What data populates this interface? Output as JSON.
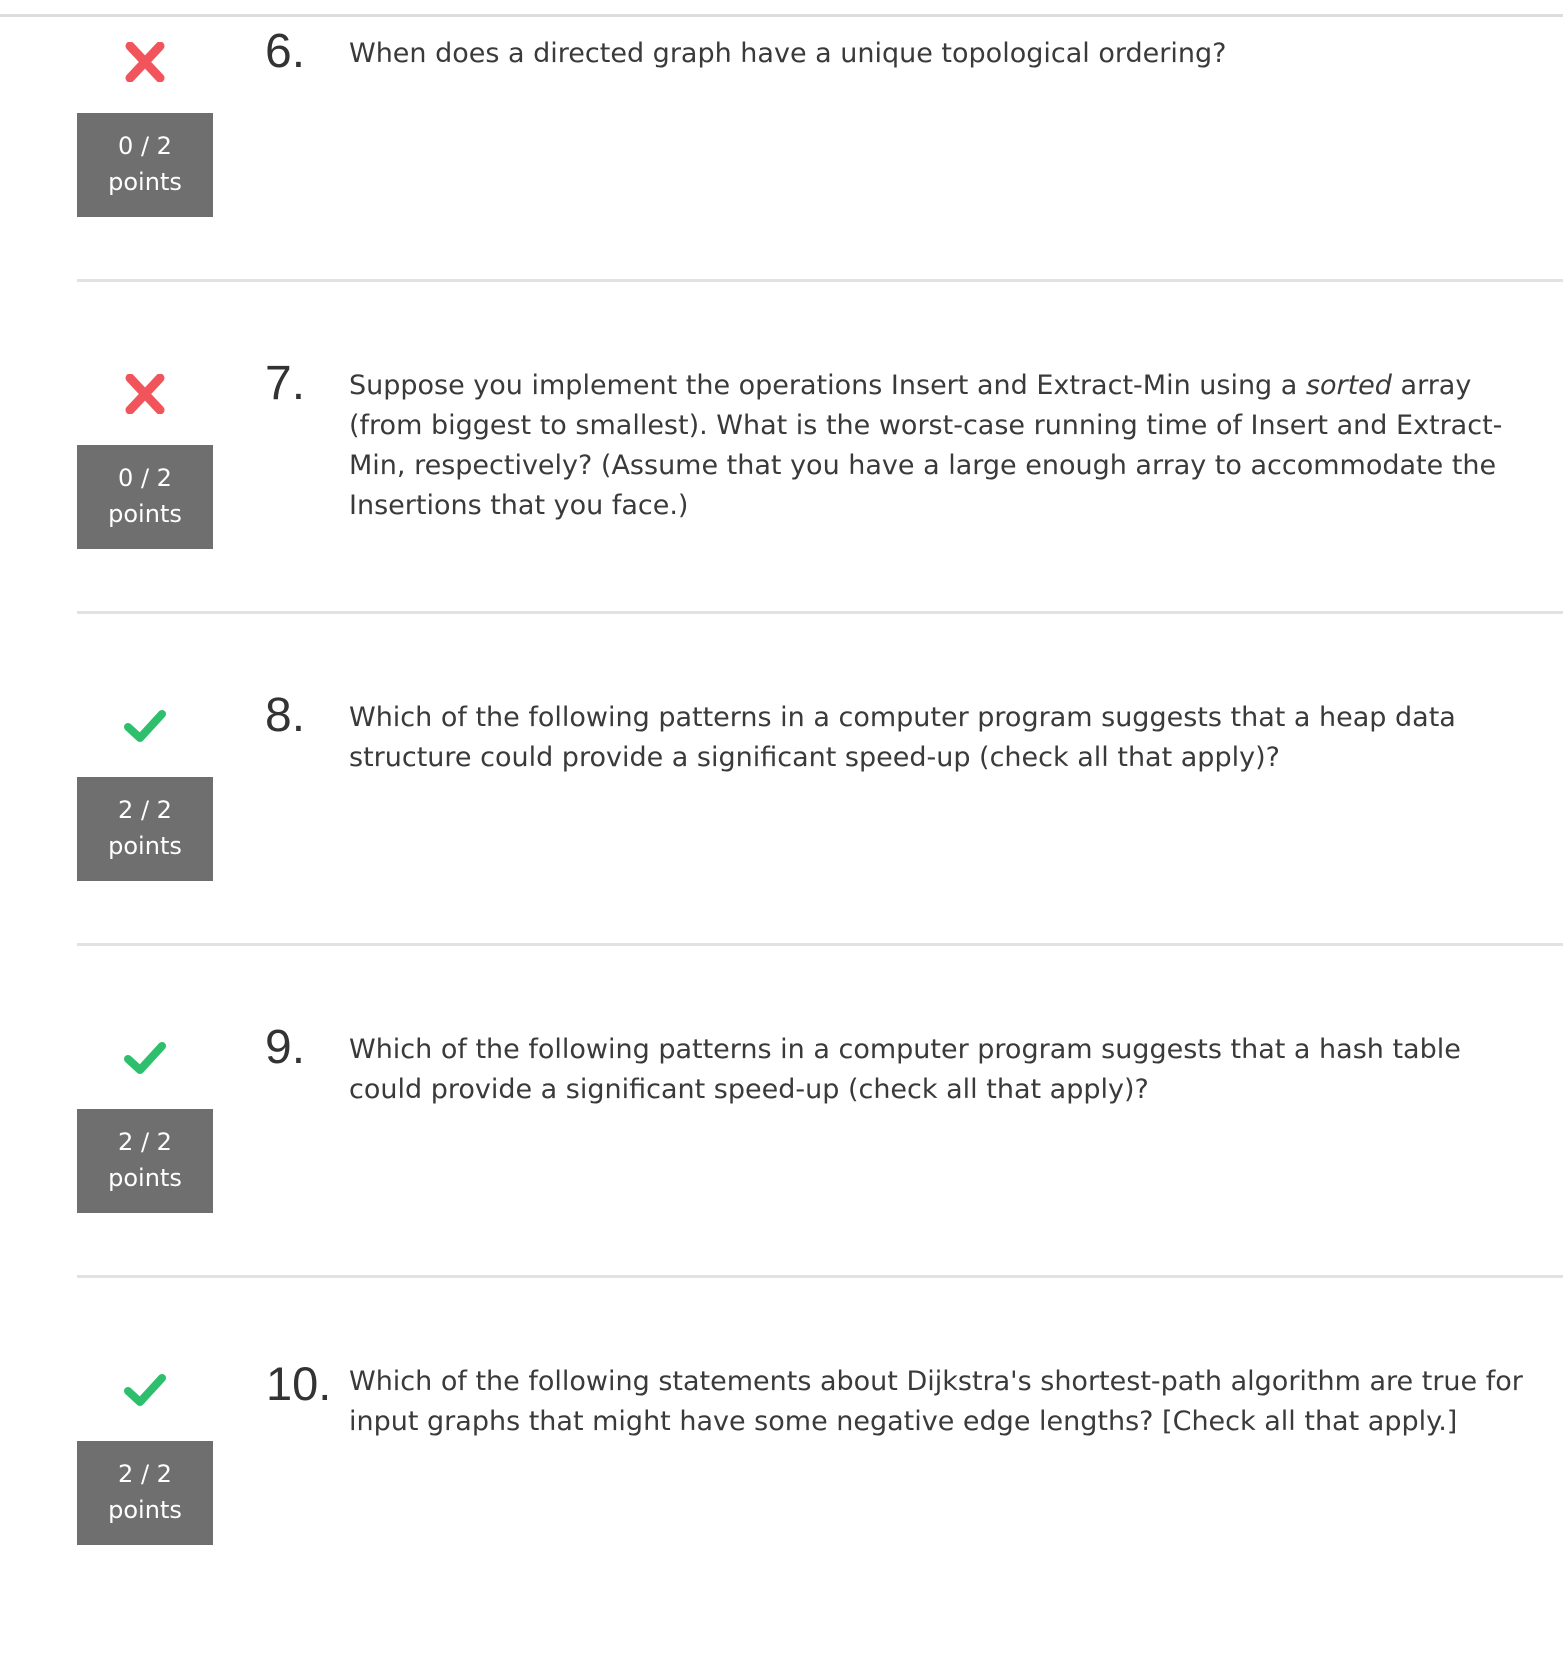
{
  "colors": {
    "correct": "#2dbf6c",
    "incorrect": "#f2545b",
    "score_box": "#6f6f6f",
    "divider": "#e2e2e2"
  },
  "questions": [
    {
      "number": "6.",
      "status": "incorrect",
      "status_icon": "x-mark-icon",
      "score": "0 / 2",
      "score_unit": "points",
      "text": "When does a directed graph have a unique topological ordering?"
    },
    {
      "number": "7.",
      "status": "incorrect",
      "status_icon": "x-mark-icon",
      "score": "0 / 2",
      "score_unit": "points",
      "text_before": "Suppose you implement the operations Insert and Extract-Min using a ",
      "text_emphasis": "sorted",
      "text_after": " array (from biggest to smallest). What is the worst-case running time of Insert and Extract-Min, respectively? (Assume that you have a large enough array to accommodate the Insertions that you face.)"
    },
    {
      "number": "8.",
      "status": "correct",
      "status_icon": "checkmark-icon",
      "score": "2 / 2",
      "score_unit": "points",
      "text": "Which of the following patterns in a computer program suggests that a heap data structure could provide a significant speed-up (check all that apply)?"
    },
    {
      "number": "9.",
      "status": "correct",
      "status_icon": "checkmark-icon",
      "score": "2 / 2",
      "score_unit": "points",
      "text": "Which of the following patterns in a computer program suggests that a hash table could provide a significant speed-up (check all that apply)?"
    },
    {
      "number": "10.",
      "status": "correct",
      "status_icon": "checkmark-icon",
      "score": "2 / 2",
      "score_unit": "points",
      "text": "Which of the following statements about Dijkstra's shortest-path algorithm are true for input graphs that might have some negative edge lengths? [Check all that apply.]"
    }
  ]
}
